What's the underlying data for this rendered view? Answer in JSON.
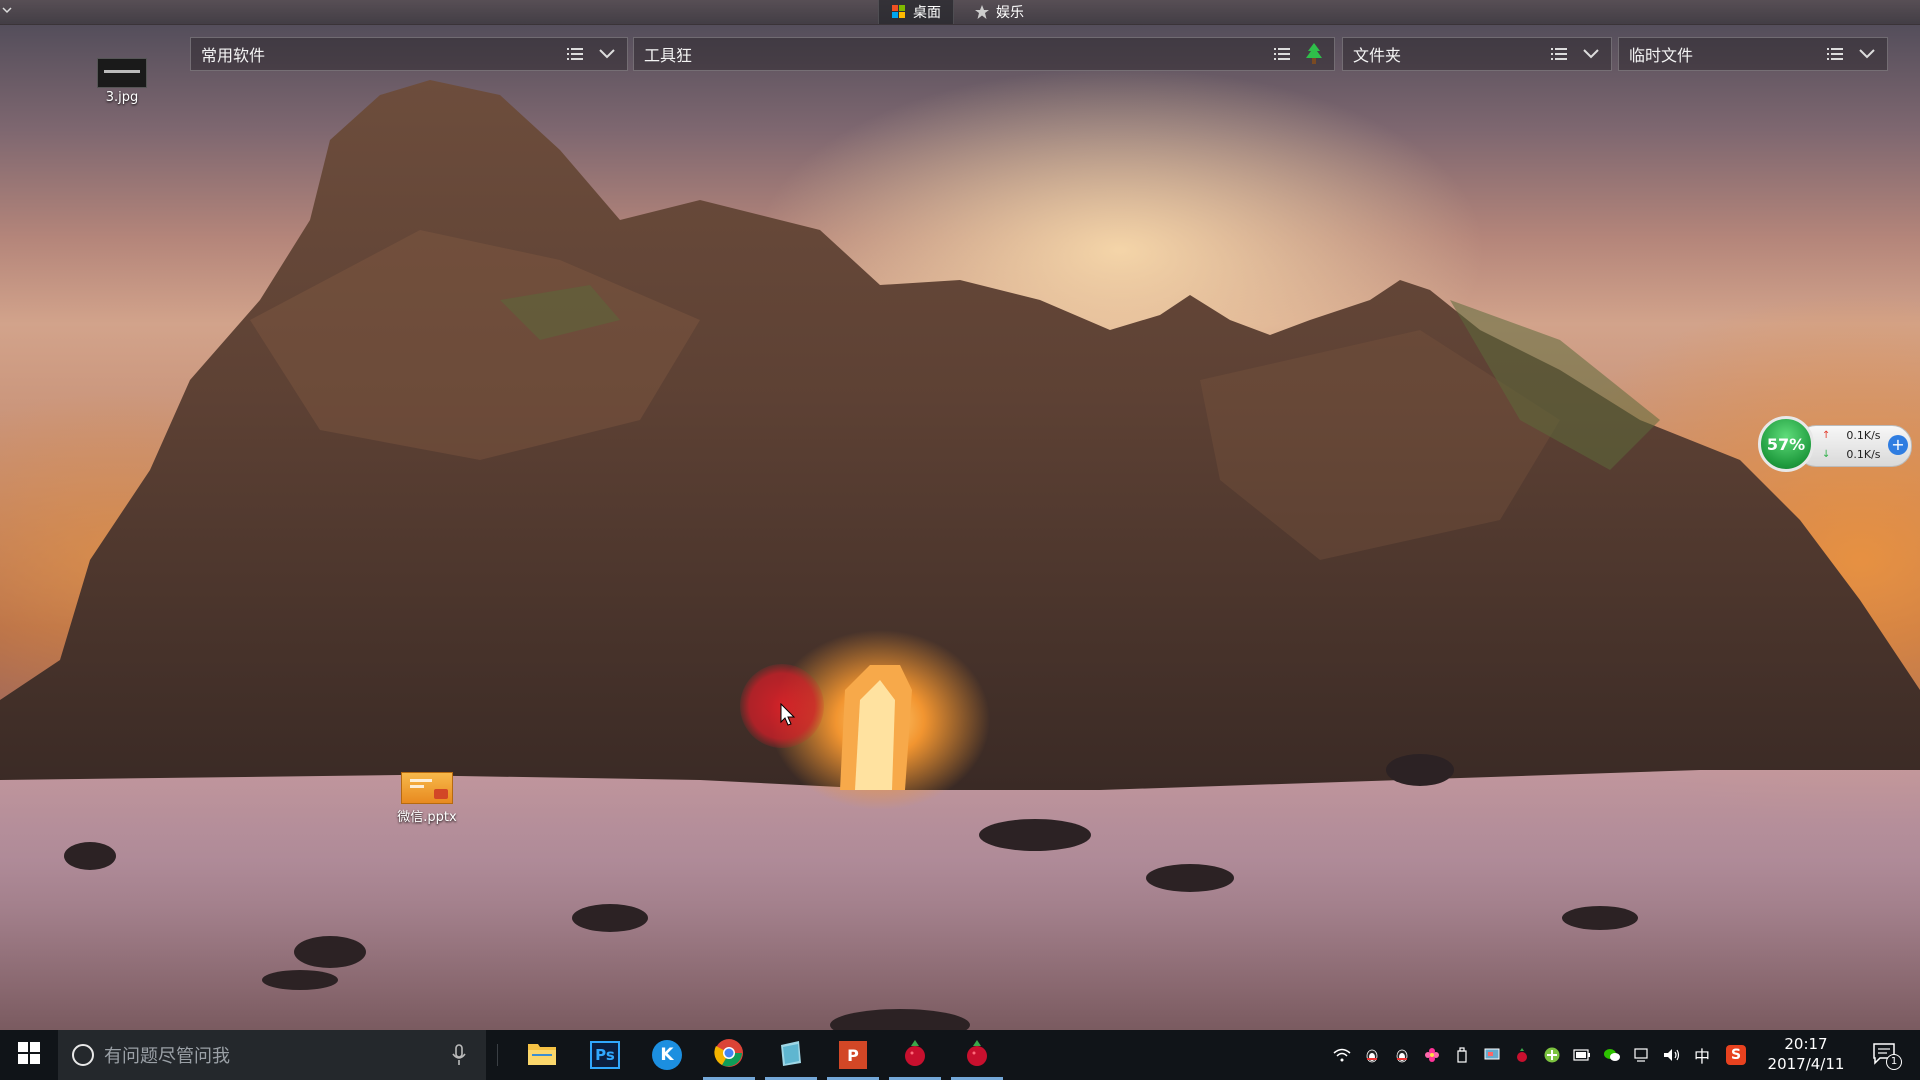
{
  "topbar": {
    "tabs": [
      {
        "label": "桌面",
        "active": true
      },
      {
        "label": "娱乐",
        "active": false
      }
    ]
  },
  "fences": [
    {
      "title": "常用软件"
    },
    {
      "title": "工具狂"
    },
    {
      "title": "文件夹"
    },
    {
      "title": "临时文件"
    }
  ],
  "desktop": {
    "icons": [
      {
        "label": "3.jpg",
        "icon": "image-thumbnail-icon"
      },
      {
        "label": "微信.pptx",
        "icon": "powerpoint-file-icon"
      }
    ]
  },
  "speed_widget": {
    "percent": "57%",
    "upload": "0.1K/s",
    "download": "0.1K/s"
  },
  "taskbar": {
    "search_placeholder": "有问题尽管问我",
    "apps": [
      {
        "name": "file-explorer-icon",
        "running": false
      },
      {
        "name": "photoshop-icon",
        "label": "Ps",
        "running": false
      },
      {
        "name": "kugou-icon",
        "label": "K",
        "running": false
      },
      {
        "name": "chrome-icon",
        "running": true
      },
      {
        "name": "notepad-app-icon",
        "running": true
      },
      {
        "name": "powerpoint-icon",
        "label": "P",
        "running": true
      },
      {
        "name": "raspberry-app-icon",
        "running": true
      },
      {
        "name": "raspberry-app-icon",
        "running": true
      }
    ],
    "tray": {
      "ime": "中",
      "sogou": "S"
    },
    "clock": {
      "time": "20:17",
      "date": "2017/4/11"
    },
    "notification_count": "1"
  },
  "colors": {
    "taskbar": "#101418",
    "accent": "#74a8d8",
    "speed_green": "#1e9a3d"
  }
}
